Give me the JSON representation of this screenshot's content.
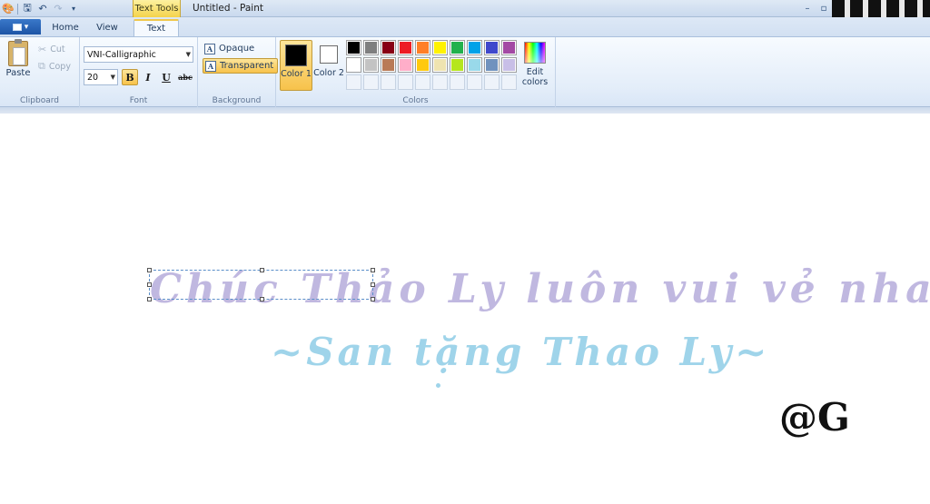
{
  "window": {
    "title": "Untitled - Paint",
    "context_tab": "Text Tools"
  },
  "tabs": [
    {
      "label": "Home"
    },
    {
      "label": "View"
    },
    {
      "label": "Text"
    }
  ],
  "clipboard": {
    "paste": "Paste",
    "cut": "Cut",
    "copy": "Copy",
    "group_label": "Clipboard"
  },
  "font": {
    "family": "VNI-Calligraphic",
    "size": "20",
    "bold": "B",
    "italic": "I",
    "underline": "U",
    "strikethrough": "abc",
    "group_label": "Font"
  },
  "background": {
    "opaque": "Opaque",
    "transparent": "Transparent",
    "group_label": "Background"
  },
  "colors": {
    "color1_label": "Color 1",
    "color2_label": "Color 2",
    "color1": "#000000",
    "color2": "#ffffff",
    "edit_label": "Edit colors",
    "group_label": "Colors",
    "palette_row1": [
      "#000000",
      "#7f7f7f",
      "#880015",
      "#ed1c24",
      "#ff7f27",
      "#fff200",
      "#22b14c",
      "#00a2e8",
      "#3f48cc",
      "#a349a4"
    ],
    "palette_row2": [
      "#ffffff",
      "#c3c3c3",
      "#b97a57",
      "#ffaec9",
      "#ffc90e",
      "#efe4b0",
      "#b5e61d",
      "#99d9ea",
      "#7092be",
      "#c8bfe7"
    ]
  },
  "canvas": {
    "line1": "Chúc Thảo Ly luôn vui vẻ nha",
    "line2": "~San tặng Thao Ly~",
    "signature": "@G",
    "line1_color": "#c0b8e0",
    "line2_color": "#9fd4ea"
  }
}
